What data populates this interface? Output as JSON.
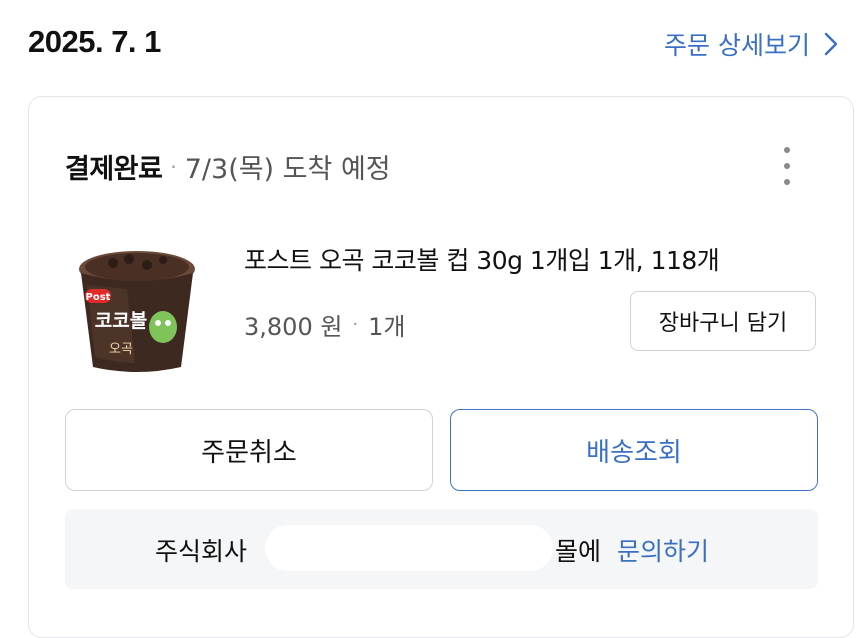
{
  "order": {
    "date": "2025. 7. 1",
    "detail_link": "주문 상세보기"
  },
  "status": {
    "label": "결제완료",
    "separator": "·",
    "arrival": "7/3(목) 도착 예정"
  },
  "product": {
    "name": "포스트 오곡 코코볼 컵 30g 1개입 1개, 118개",
    "price": "3,800 원",
    "separator": "·",
    "quantity": "1개",
    "thumbnail_brand": "Post",
    "thumbnail_title": "코코볼",
    "thumbnail_sub": "오곡"
  },
  "buttons": {
    "add_to_cart": "장바구니 담기",
    "cancel_order": "주문취소",
    "track_delivery": "배송조회"
  },
  "inquiry": {
    "company_prefix": "주식회사",
    "mall_suffix": "몰에",
    "link": "문의하기"
  },
  "colors": {
    "accent": "#3a6fc4",
    "border": "#cfd2d6",
    "inquiry_bg": "#f5f6f7"
  },
  "icons": {
    "detail_chevron": "chevron-right-icon",
    "more_menu": "more-vertical-icon"
  }
}
